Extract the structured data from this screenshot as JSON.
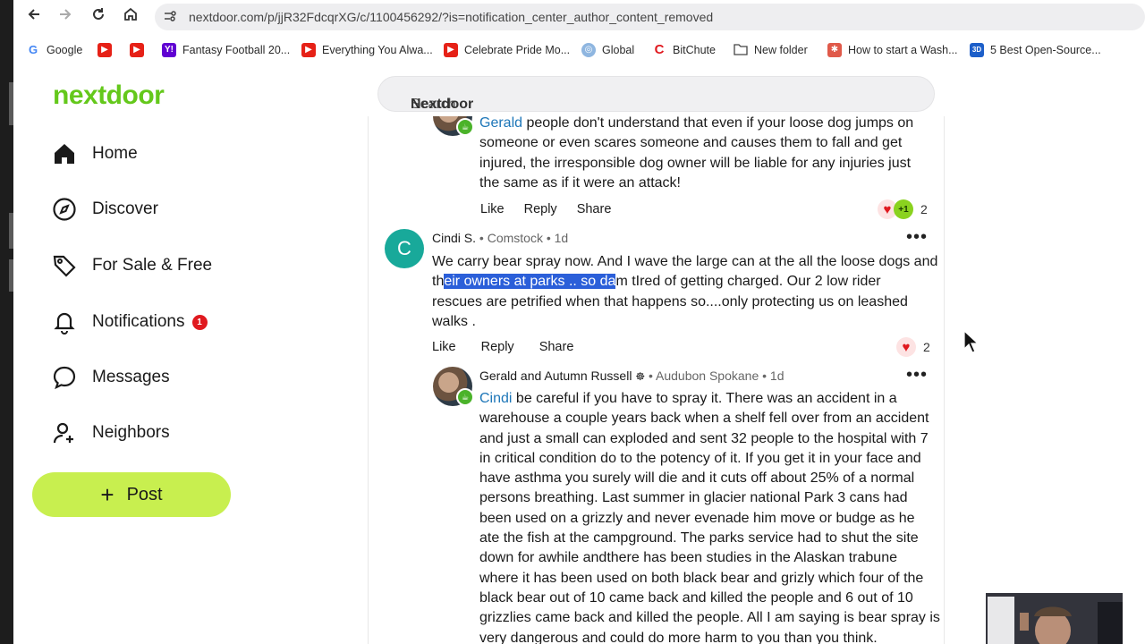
{
  "browser": {
    "url": "nextdoor.com/p/jjR32FdcqrXG/c/1100456292/?is=notification_center_author_content_removed",
    "bookmarks": [
      {
        "label": "Google",
        "icon": "google-icon"
      },
      {
        "label": "",
        "icon": "youtube-icon"
      },
      {
        "label": "",
        "icon": "youtube-icon"
      },
      {
        "label": "Fantasy Football 20...",
        "icon": "yahoo-icon"
      },
      {
        "label": "Everything You Alwa...",
        "icon": "youtube-icon"
      },
      {
        "label": "Celebrate Pride Mo...",
        "icon": "youtube-icon"
      },
      {
        "label": "Global",
        "icon": "globe-icon"
      },
      {
        "label": "BitChute",
        "icon": "bitchute-icon"
      },
      {
        "label": "New folder",
        "icon": "folder-icon"
      },
      {
        "label": "How to start a Wash...",
        "icon": "site-icon"
      },
      {
        "label": "5 Best Open-Source...",
        "icon": "3d-icon"
      }
    ]
  },
  "app": {
    "logo": "nextdoor",
    "search_placeholder_prefix": "Search ",
    "search_placeholder_brand": "Nextdoor",
    "brand_color": "#64c81b",
    "post_button_color": "#c8ef4f"
  },
  "sidebar": {
    "items": [
      {
        "label": "Home",
        "icon": "home-icon"
      },
      {
        "label": "Discover",
        "icon": "compass-icon"
      },
      {
        "label": "For Sale & Free",
        "icon": "tag-icon"
      },
      {
        "label": "Notifications",
        "icon": "bell-icon",
        "badge": "1"
      },
      {
        "label": "Messages",
        "icon": "chat-bubble-icon"
      },
      {
        "label": "Neighbors",
        "icon": "add-person-icon"
      }
    ],
    "post_label": "Post"
  },
  "comments": [
    {
      "mention": "Gerald",
      "text": " people don't understand that even if your loose dog jumps on someone or even scares someone and causes them to fall and get injured, the irresponsible dog owner will be liable for any injuries just the same as if it were an attack!",
      "lines": [
        "people don't understand that even if your loose dog jumps on",
        "someone or even scares someone and causes them to fall and get",
        "injured, the irresponsible dog owner will be liable for any injuries just",
        "the same as if it were an attack!"
      ],
      "actions": [
        "Like",
        "Reply",
        "Share"
      ],
      "reaction_count": "2"
    },
    {
      "author": "Cindi S.",
      "neighborhood": "Comstock",
      "age": "1d",
      "avatar_letter": "C",
      "line1": "We carry bear spray now. And I wave the large can at the all the loose dogs and",
      "line2_pre": "th",
      "line2_sel": "eir owners at parks .. so da",
      "line2_post": "m tIred of getting charged. Our 2 low rider",
      "line3": "rescues are petrified when that happens so....only protecting us on leashed",
      "line4": "walks .",
      "actions": [
        "Like",
        "Reply",
        "Share"
      ],
      "reaction_count": "2"
    },
    {
      "author": "Gerald and Autumn Russell",
      "neighborhood": "Audubon Spokane",
      "age": "1d",
      "mention": "Cindi",
      "lines": [
        "be careful if you have to spray it. There was an accident in a",
        "warehouse a couple years back when a shelf fell over from an accident",
        "and just a small can exploded and sent 32 people to the hospital with 7",
        "in critical condition do to the potency of it. If you get it in your face and",
        "have asthma you surely will die and it cuts off about 25% of a normal",
        "persons breathing. Last summer in glacier national Park 3 cans had",
        "been used on a grizzly and never evenade him move or budge as he",
        "ate the fish at the campground. The parks service had to shut the site",
        "down for awhile andthere has been studies in the Alaskan trabune",
        "where it has been used on both black bear and grizly which four of the",
        "black bear out of 10 came back and killed the people and 6 out of 10",
        "grizzlies came back and killed the people. All I am saying is bear spray is",
        "very dangerous and could do more harm to you than you think."
      ]
    }
  ]
}
